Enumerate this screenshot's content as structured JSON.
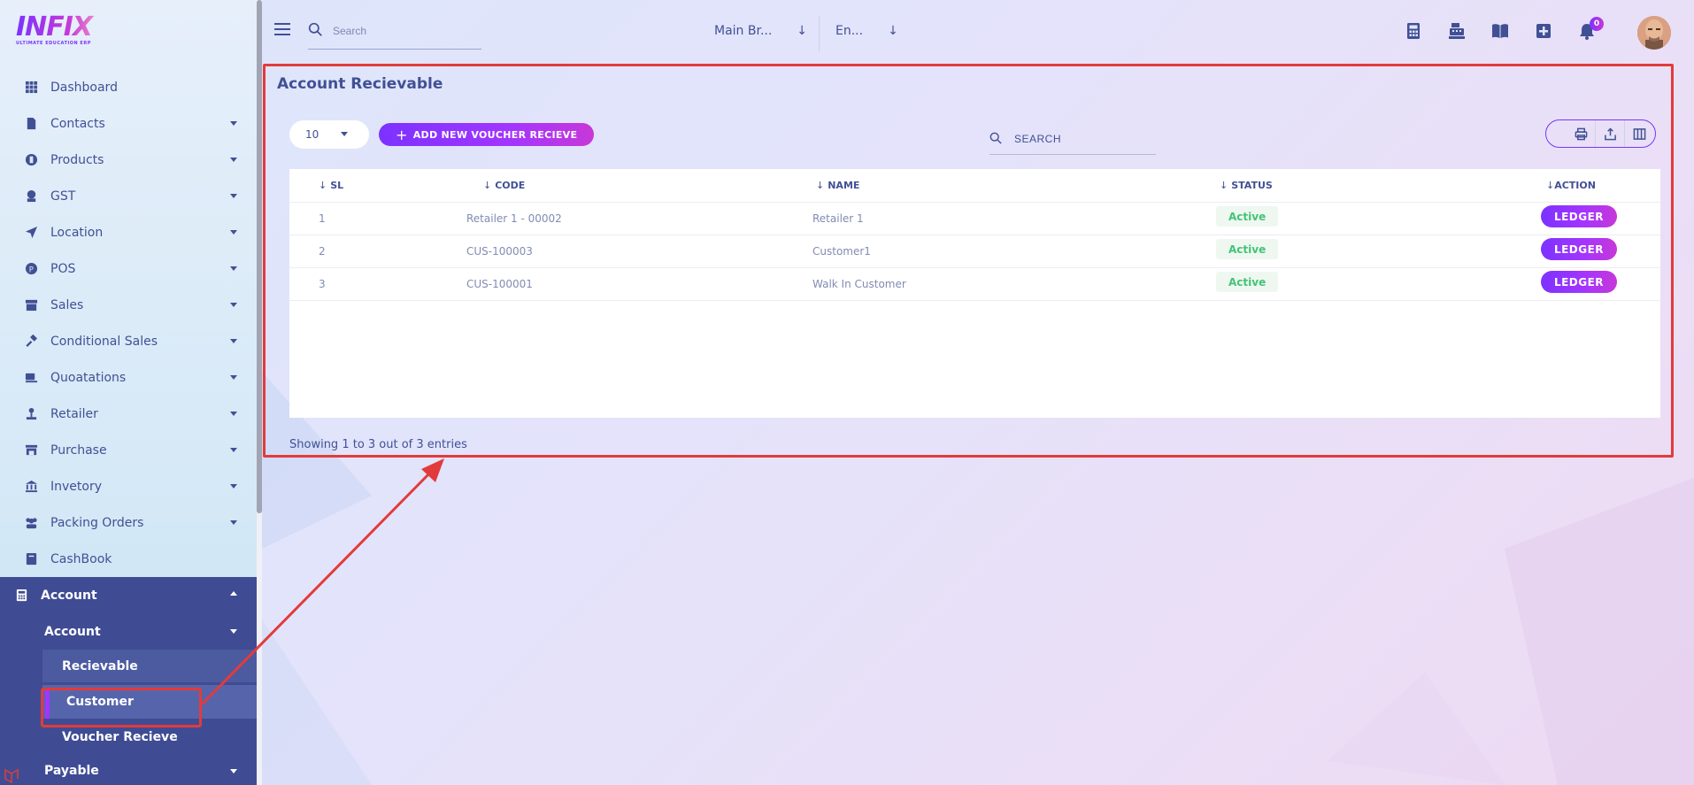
{
  "logo": {
    "title": "INFIX",
    "subtitle": "ULTIMATE EDUCATION ERP"
  },
  "sidebar": {
    "items": [
      {
        "label": "Dashboard",
        "icon": "grid-icon",
        "caret": false
      },
      {
        "label": "Contacts",
        "icon": "contact-file-icon",
        "caret": true
      },
      {
        "label": "Products",
        "icon": "product-circle-icon",
        "caret": true
      },
      {
        "label": "GST",
        "icon": "gst-badge-icon",
        "caret": true
      },
      {
        "label": "Location",
        "icon": "location-arrow-icon",
        "caret": true
      },
      {
        "label": "POS",
        "icon": "pos-icon",
        "caret": true
      },
      {
        "label": "Sales",
        "icon": "store-icon",
        "caret": true
      },
      {
        "label": "Conditional Sales",
        "icon": "gavel-icon",
        "caret": true
      },
      {
        "label": "Quoatations",
        "icon": "coffee-icon",
        "caret": true
      },
      {
        "label": "Retailer",
        "icon": "retailer-icon",
        "caret": true
      },
      {
        "label": "Purchase",
        "icon": "shop-icon",
        "caret": true
      },
      {
        "label": "Invetory",
        "icon": "bank-icon",
        "caret": true
      },
      {
        "label": "Packing Orders",
        "icon": "users-icon",
        "caret": true
      },
      {
        "label": "CashBook",
        "icon": "book-icon",
        "caret": false
      }
    ],
    "account": {
      "label": "Account",
      "sub_label": "Account",
      "recievable": "Recievable",
      "customer": "Customer",
      "voucher": "Voucher Recieve",
      "payable": "Payable"
    }
  },
  "topbar": {
    "search_placeholder": "Search",
    "branch": "Main Br...",
    "language": "En...",
    "notifications": "0"
  },
  "main": {
    "title": "Account Recievable",
    "per_page": "10",
    "add_button": "ADD NEW VOUCHER RECIEVE",
    "search_placeholder": "SEARCH",
    "columns": [
      "SL",
      "CODE",
      "NAME",
      "STATUS",
      "ACTION"
    ],
    "rows": [
      {
        "sl": "1",
        "code": "Retailer 1 - 00002",
        "name": "Retailer 1",
        "status": "Active",
        "action": "LEDGER"
      },
      {
        "sl": "2",
        "code": "CUS-100003",
        "name": "Customer1",
        "status": "Active",
        "action": "LEDGER"
      },
      {
        "sl": "3",
        "code": "CUS-100001",
        "name": "Walk In Customer",
        "status": "Active",
        "action": "LEDGER"
      }
    ],
    "entries": "Showing 1 to 3 out of 3 entries"
  },
  "colors": {
    "accent": "#7c32ff",
    "accent_end": "#c738d8",
    "text": "#415094",
    "highlight": "#e23b3b",
    "status_green": "#44c377",
    "sidebar_dark": "#3f4c94"
  }
}
